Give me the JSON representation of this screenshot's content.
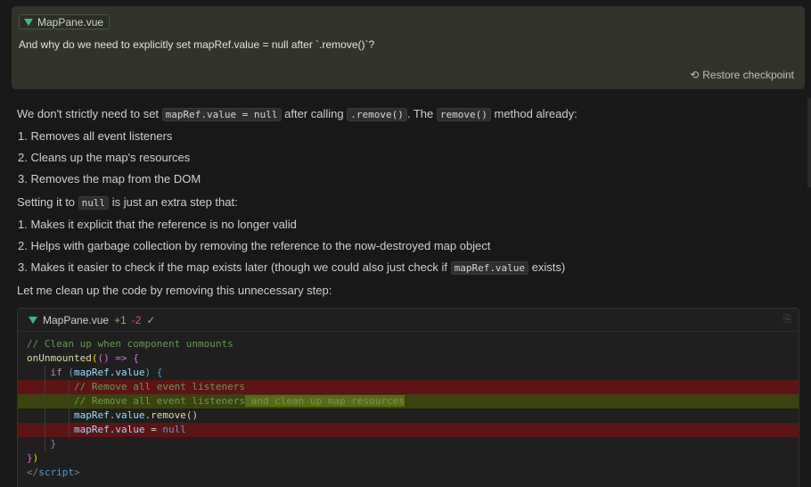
{
  "user_message": {
    "file_chip": "MapPane.vue",
    "text": "And why do we need to explicitly set mapRef.value = null after `.remove()`?",
    "restore_label": "Restore checkpoint"
  },
  "assistant": {
    "p1": {
      "a": "We don't strictly need to set",
      "c1": "mapRef.value = null",
      "b": "after calling",
      "c2": ".remove()",
      "d": ". The",
      "c3": "remove()",
      "e": "method already:"
    },
    "list1": [
      "1. Removes all event listeners",
      "2. Cleans up the map's resources",
      "3. Removes the map from the DOM"
    ],
    "p2": {
      "a": "Setting it to",
      "c": "null",
      "b": "is just an extra step that:"
    },
    "list2": {
      "i1": "1. Makes it explicit that the reference is no longer valid",
      "i2": "2. Helps with garbage collection by removing the reference to the now-destroyed map object",
      "i3a": "3. Makes it easier to check if the map exists later (though we could also just check if",
      "i3c": "mapRef.value",
      "i3b": "exists)"
    },
    "p3": "Let me clean up the code by removing this unnecessary step:"
  },
  "code_block": {
    "filename": "MapPane.vue",
    "added": "+1",
    "removed": "-2",
    "lines": {
      "l1": "// Clean up when component unmounts",
      "l2a": "onUnmounted",
      "l2b": "(",
      "l2c": "() =>",
      "l2d": "{",
      "l3a": "if",
      "l3b": "(",
      "l3c": "mapRef",
      "l3d": ".",
      "l3e": "value",
      "l3f": ")",
      "l3g": "{",
      "l4": "// Remove all event listeners",
      "l5a": "// Remove all event listeners",
      "l5b": " and clean up map resources",
      "l6a": "mapRef",
      "l6b": ".value.",
      "l6c": "remove",
      "l6d": "()",
      "l7a": "mapRef",
      "l7b": ".value",
      "l7c": " = ",
      "l7d": "null",
      "l8": "}",
      "l9a": "}",
      "l9b": ")",
      "l10a": "</",
      "l10b": "script",
      "l10c": ">"
    }
  },
  "colors": {
    "user_card_bg": "#313529",
    "removed_bg": "#5c1414",
    "added_bg": "#3a4210",
    "vue_green": "#41b883"
  },
  "icons": {
    "vue": "vue-file-icon",
    "restore": "restore-icon",
    "check": "check-icon"
  }
}
